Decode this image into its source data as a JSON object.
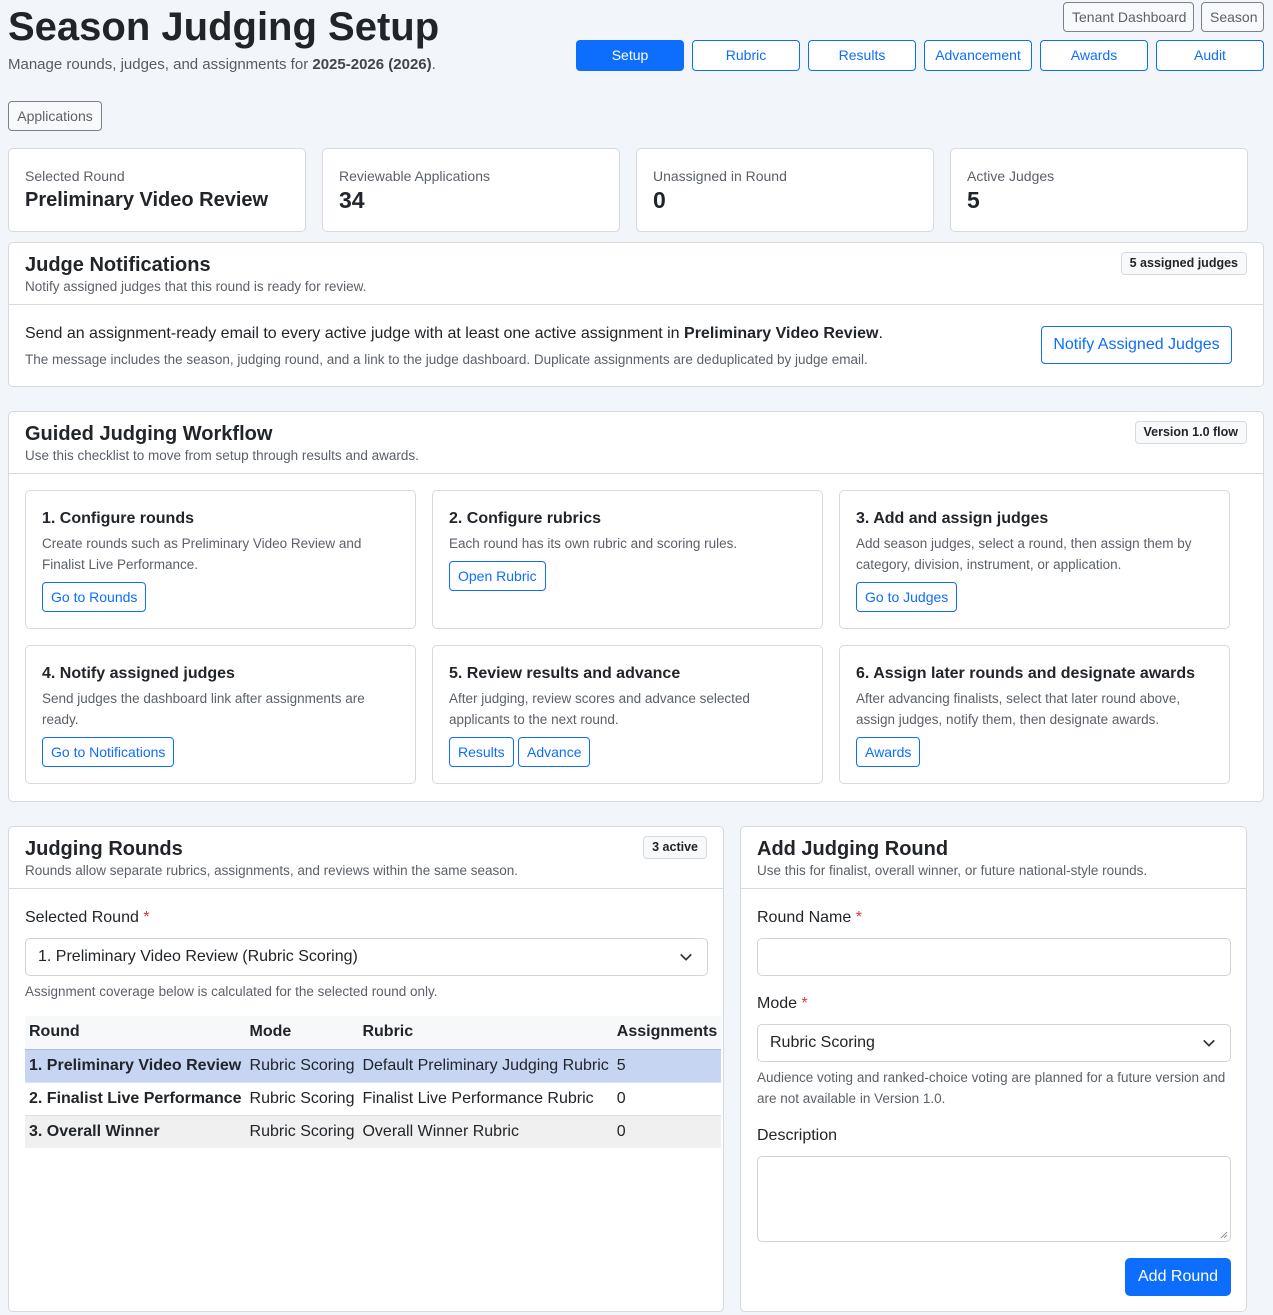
{
  "header": {
    "title": "Season Judging Setup",
    "subtitle_prefix": "Manage rounds, judges, and assignments for ",
    "subtitle_season": "2025-2026 (2026)",
    "subtitle_suffix": ".",
    "top_links": [
      "Tenant Dashboard",
      "Season"
    ],
    "nav_tabs": [
      "Setup",
      "Rubric",
      "Results",
      "Advancement",
      "Awards",
      "Audit"
    ],
    "active_tab": "Setup",
    "applications_link": "Applications"
  },
  "stats": [
    {
      "label": "Selected Round",
      "value": "Preliminary Video Review"
    },
    {
      "label": "Reviewable Applications",
      "value": "34"
    },
    {
      "label": "Unassigned in Round",
      "value": "0"
    },
    {
      "label": "Active Judges",
      "value": "5"
    }
  ],
  "notifications": {
    "title": "Judge Notifications",
    "subtitle": "Notify assigned judges that this round is ready for review.",
    "badge": "5 assigned judges",
    "message_prefix": "Send an assignment-ready email to every active judge with at least one active assignment in ",
    "message_round": "Preliminary Video Review",
    "message_suffix": ".",
    "detail": "The message includes the season, judging round, and a link to the judge dashboard. Duplicate assignments are deduplicated by judge email.",
    "button": "Notify Assigned Judges"
  },
  "workflow": {
    "title": "Guided Judging Workflow",
    "subtitle": "Use this checklist to move from setup through results and awards.",
    "badge": "Version 1.0 flow",
    "steps": [
      {
        "title": "1. Configure rounds",
        "desc": "Create rounds such as Preliminary Video Review and Finalist Live Performance.",
        "buttons": [
          "Go to Rounds"
        ]
      },
      {
        "title": "2. Configure rubrics",
        "desc": "Each round has its own rubric and scoring rules.",
        "buttons": [
          "Open Rubric"
        ]
      },
      {
        "title": "3. Add and assign judges",
        "desc": "Add season judges, select a round, then assign them by category, division, instrument, or application.",
        "buttons": [
          "Go to Judges"
        ]
      },
      {
        "title": "4. Notify assigned judges",
        "desc": "Send judges the dashboard link after assignments are ready.",
        "buttons": [
          "Go to Notifications"
        ]
      },
      {
        "title": "5. Review results and advance",
        "desc": "After judging, review scores and advance selected applicants to the next round.",
        "buttons": [
          "Results",
          "Advance"
        ]
      },
      {
        "title": "6. Assign later rounds and designate awards",
        "desc": "After advancing finalists, select that later round above, assign judges, notify them, then designate awards.",
        "buttons": [
          "Awards"
        ]
      }
    ]
  },
  "rounds": {
    "title": "Judging Rounds",
    "subtitle": "Rounds allow separate rubrics, assignments, and reviews within the same season.",
    "badge": "3 active",
    "select_label": "Selected Round",
    "select_value": "1. Preliminary Video Review (Rubric Scoring)",
    "coverage_note": "Assignment coverage below is calculated for the selected round only.",
    "columns": [
      "Round",
      "Mode",
      "Rubric",
      "Assignments"
    ],
    "rows": [
      {
        "round": "1. Preliminary Video Review",
        "mode": "Rubric Scoring",
        "rubric": "Default Preliminary Judging Rubric",
        "assignments": "5"
      },
      {
        "round": "2. Finalist Live Performance",
        "mode": "Rubric Scoring",
        "rubric": "Finalist Live Performance Rubric",
        "assignments": "0"
      },
      {
        "round": "3. Overall Winner",
        "mode": "Rubric Scoring",
        "rubric": "Overall Winner Rubric",
        "assignments": "0"
      }
    ]
  },
  "add_round": {
    "title": "Add Judging Round",
    "subtitle": "Use this for finalist, overall winner, or future national-style rounds.",
    "name_label": "Round Name",
    "name_value": "",
    "mode_label": "Mode",
    "mode_value": "Rubric Scoring",
    "mode_help": "Audience voting and ranked-choice voting are planned for a future version and are not available in Version 1.0.",
    "description_label": "Description",
    "description_value": "",
    "submit": "Add Round"
  },
  "colors": {
    "primary": "#0d6efd",
    "selected_row": "#c6d6f2",
    "required": "#dc3545"
  }
}
